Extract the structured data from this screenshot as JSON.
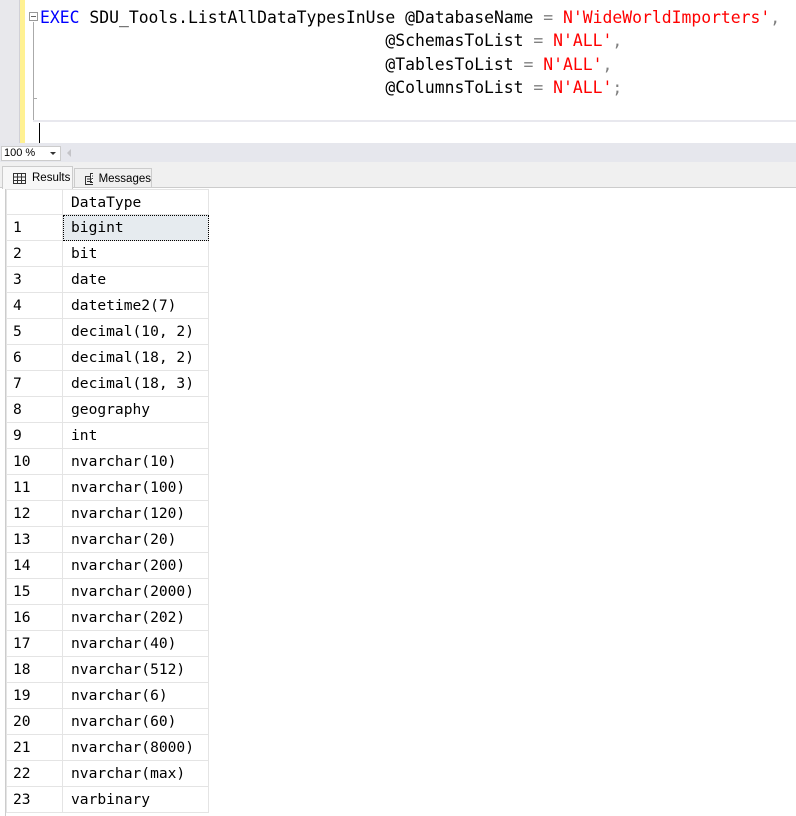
{
  "editor": {
    "lines": [
      [
        {
          "t": "EXEC",
          "c": "kw"
        },
        {
          "t": " SDU_Tools.ListAllDataTypesInUse "
        },
        {
          "t": "@DatabaseName "
        },
        {
          "t": "=",
          "c": "op"
        },
        {
          "t": " "
        },
        {
          "t": "N'WideWorldImporters'",
          "c": "str"
        },
        {
          "t": ",",
          "c": "op"
        }
      ],
      [
        {
          "t": "                                   @SchemasToList "
        },
        {
          "t": "=",
          "c": "op"
        },
        {
          "t": " "
        },
        {
          "t": "N'ALL'",
          "c": "str"
        },
        {
          "t": ",",
          "c": "op"
        }
      ],
      [
        {
          "t": "                                   @TablesToList "
        },
        {
          "t": "=",
          "c": "op"
        },
        {
          "t": " "
        },
        {
          "t": "N'ALL'",
          "c": "str"
        },
        {
          "t": ",",
          "c": "op"
        }
      ],
      [
        {
          "t": "                                   @ColumnsToList "
        },
        {
          "t": "=",
          "c": "op"
        },
        {
          "t": " "
        },
        {
          "t": "N'ALL'",
          "c": "str"
        },
        {
          "t": ";",
          "c": "op"
        }
      ]
    ]
  },
  "zoom": {
    "value": "100 %"
  },
  "tabs": {
    "results": "Results",
    "messages": "Messages"
  },
  "grid": {
    "header": "DataType",
    "rows": [
      "bigint",
      "bit",
      "date",
      "datetime2(7)",
      "decimal(10, 2)",
      "decimal(18, 2)",
      "decimal(18, 3)",
      "geography",
      "int",
      "nvarchar(10)",
      "nvarchar(100)",
      "nvarchar(120)",
      "nvarchar(20)",
      "nvarchar(200)",
      "nvarchar(2000)",
      "nvarchar(202)",
      "nvarchar(40)",
      "nvarchar(512)",
      "nvarchar(6)",
      "nvarchar(60)",
      "nvarchar(8000)",
      "nvarchar(max)",
      "varbinary"
    ]
  }
}
